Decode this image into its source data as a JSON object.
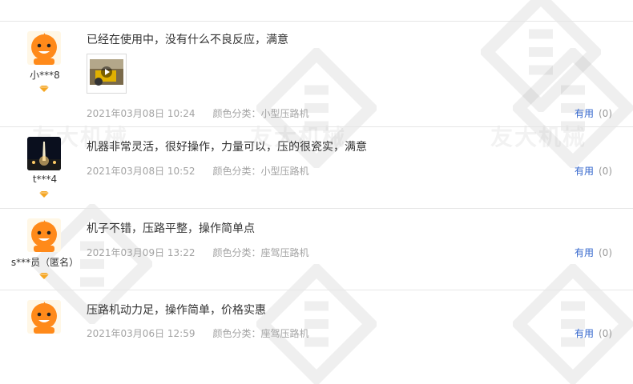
{
  "reviews": [
    {
      "nick": "小***8",
      "content": "已经在使用中，没有什么不良反应，满意",
      "date": "2021年03月08日 10:24",
      "color_label": "颜色分类：",
      "color_value": "小型压路机",
      "useful_label": "有用",
      "useful_count": "(0)",
      "has_thumb": true
    },
    {
      "nick": "t***4",
      "content": "机器非常灵活，很好操作，力量可以，压的很瓷实，满意",
      "date": "2021年03月08日 10:52",
      "color_label": "颜色分类：",
      "color_value": "小型压路机",
      "useful_label": "有用",
      "useful_count": "(0)"
    },
    {
      "nick": "s***员（匿名）",
      "content": "机子不错，压路平整，操作简单点",
      "date": "2021年03月09日 13:22",
      "color_label": "颜色分类：",
      "color_value": "座驾压路机",
      "useful_label": "有用",
      "useful_count": "(0)"
    },
    {
      "nick": "",
      "content": "压路机动力足，操作简单，价格实惠",
      "date": "2021年03月06日 12:59",
      "color_label": "颜色分类：",
      "color_value": "座驾压路机",
      "useful_label": "有用",
      "useful_count": "(0)"
    }
  ],
  "watermark_text": "友大机械"
}
